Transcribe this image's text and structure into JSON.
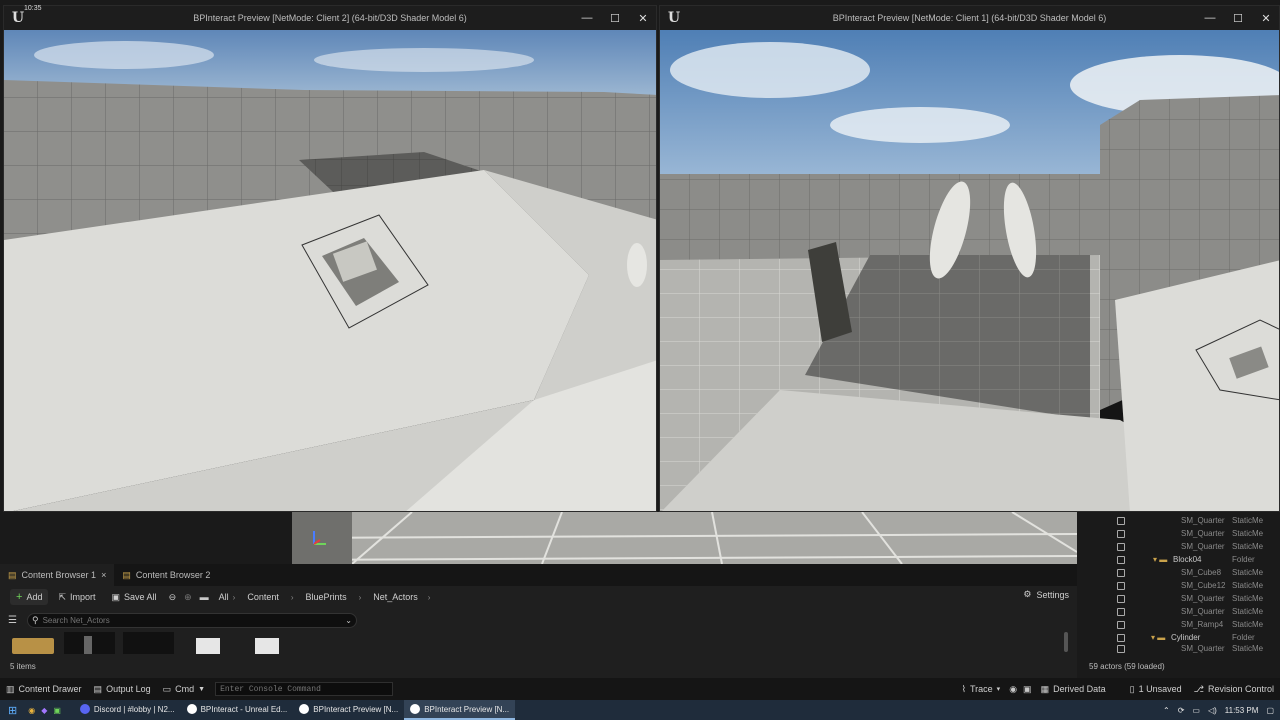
{
  "clock": "10:35",
  "windows": {
    "client2": {
      "title": "BPInteract Preview [NetMode: Client 2]  (64-bit/D3D Shader Model 6)"
    },
    "client1": {
      "title": "BPInteract Preview [NetMode: Client 1]  (64-bit/D3D Shader Model 6)"
    },
    "controls": {
      "minimize": "—",
      "maximize": "☐",
      "close": "✕"
    }
  },
  "content_browser": {
    "tabs": [
      {
        "label": "Content Browser 1",
        "close": "×"
      },
      {
        "label": "Content Browser 2"
      }
    ],
    "toolbar": {
      "add": "Add",
      "import": "Import",
      "save_all": "Save All"
    },
    "breadcrumbs": [
      "All",
      "Content",
      "BluePrints",
      "Net_Actors"
    ],
    "settings": "Settings",
    "search_placeholder": "Search Net_Actors",
    "item_count": "5 items"
  },
  "outliner": {
    "rows": [
      {
        "name": "SM_Quarter",
        "type": "StaticMe"
      },
      {
        "name": "SM_Quarter",
        "type": "StaticMe"
      },
      {
        "name": "SM_Quarter",
        "type": "StaticMe"
      },
      {
        "name": "Block04",
        "type": "Folder"
      },
      {
        "name": "SM_Cube8",
        "type": "StaticMe"
      },
      {
        "name": "SM_Cube12",
        "type": "StaticMe"
      },
      {
        "name": "SM_Quarter",
        "type": "StaticMe"
      },
      {
        "name": "SM_Quarter",
        "type": "StaticMe"
      },
      {
        "name": "SM_Ramp4",
        "type": "StaticMe"
      },
      {
        "name": "Cylinder",
        "type": "Folder"
      },
      {
        "name": "SM_Quarter",
        "type": "StaticMe"
      }
    ],
    "actors": "59 actors (59 loaded)"
  },
  "status_bar": {
    "content_drawer": "Content Drawer",
    "output_log": "Output Log",
    "cmd": "Cmd",
    "console_placeholder": "Enter Console Command",
    "trace": "Trace",
    "derived_data": "Derived Data",
    "unsaved": "1 Unsaved",
    "revision_control": "Revision Control"
  },
  "taskbar": {
    "items": [
      {
        "label": "Discord | #lobby | N2...",
        "color": "#5865f2"
      },
      {
        "label": "BPInteract - Unreal Ed...",
        "color": "#ffffff"
      },
      {
        "label": "BPInteract Preview [N...",
        "color": "#ffffff"
      },
      {
        "label": "BPInteract Preview [N...",
        "color": "#ffffff"
      }
    ],
    "time": "11:53 PM"
  }
}
